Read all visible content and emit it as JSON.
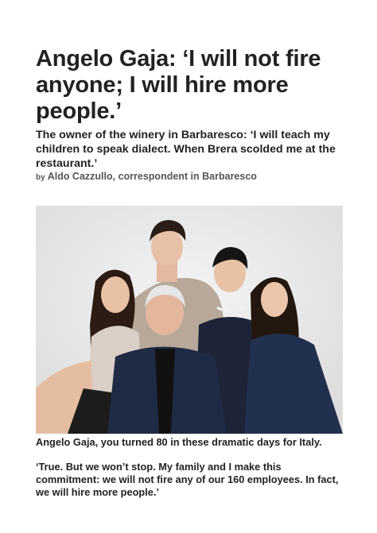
{
  "article": {
    "headline": "Angelo Gaja: ‘I will not fire anyone; I will hire more people.’",
    "subheadline": "The owner of the winery in Barbaresco: ‘I will teach my children to speak dialect. When Brera scolded me at the restaurant.’",
    "byline_prefix": "by",
    "byline_author": "Aldo Cazzullo, correspondent in Barbaresco",
    "photo": {
      "subject": "family-portrait",
      "background_color": "#e9e9e9"
    },
    "caption": "Angelo Gaja, you turned 80 in these dramatic days for Italy.",
    "answer": "‘True. But we won’t stop. My family and I make this commitment: we will not fire any of our 160 employees. In fact, we will hire more people.’"
  }
}
